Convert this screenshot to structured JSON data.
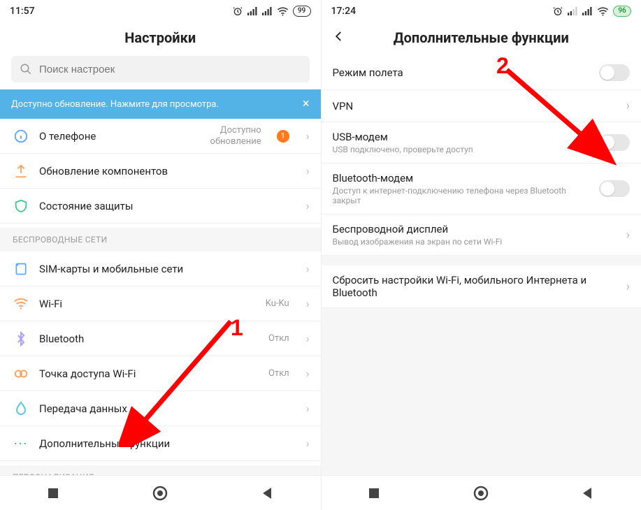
{
  "left": {
    "status": {
      "time": "11:57",
      "battery": "99"
    },
    "title": "Настройки",
    "search_placeholder": "Поиск настроек",
    "banner_text": "Доступно обновление. Нажмите для просмотра.",
    "rows_top": [
      {
        "icon": "info",
        "label": "О телефоне",
        "meta": "Доступно\nобновление",
        "badge": "1"
      },
      {
        "icon": "upload",
        "label": "Обновление компонентов"
      },
      {
        "icon": "shield",
        "label": "Состояние защиты"
      }
    ],
    "section_wireless": "БЕСПРОВОДНЫЕ СЕТИ",
    "rows_wireless": [
      {
        "icon": "sim",
        "label": "SIM-карты и мобильные сети"
      },
      {
        "icon": "wifi",
        "label": "Wi-Fi",
        "meta": "Ku-Ku"
      },
      {
        "icon": "bt",
        "label": "Bluetooth",
        "meta": "Откл"
      },
      {
        "icon": "hotspot",
        "label": "Точка доступа Wi-Fi",
        "meta": "Откл"
      },
      {
        "icon": "drop",
        "label": "Передача данных"
      },
      {
        "icon": "dots",
        "label": "Дополнительные функции"
      }
    ],
    "section_personal": "ПЕРСОНАЛИЗАЦИЯ",
    "annotation": "1"
  },
  "right": {
    "status": {
      "time": "17:24",
      "battery": "96"
    },
    "title": "Дополнительные функции",
    "rows": [
      {
        "title": "Режим полета",
        "control": "toggle"
      },
      {
        "title": "VPN",
        "control": "chev"
      },
      {
        "title": "USB-модем",
        "desc": "USB подключено, проверьте доступ",
        "control": "toggle"
      },
      {
        "title": "Bluetooth-модем",
        "desc": "Доступ к интернет-подключению телефона через Bluetooth закрыт",
        "control": "toggle"
      },
      {
        "title": "Беспроводной дисплей",
        "desc": "Вывод изображения на экран по сети Wi-Fi",
        "control": "chev"
      }
    ],
    "reset_row": {
      "title": "Сбросить настройки Wi-Fi, мобильного Интернета и Bluetooth"
    },
    "annotation": "2"
  }
}
